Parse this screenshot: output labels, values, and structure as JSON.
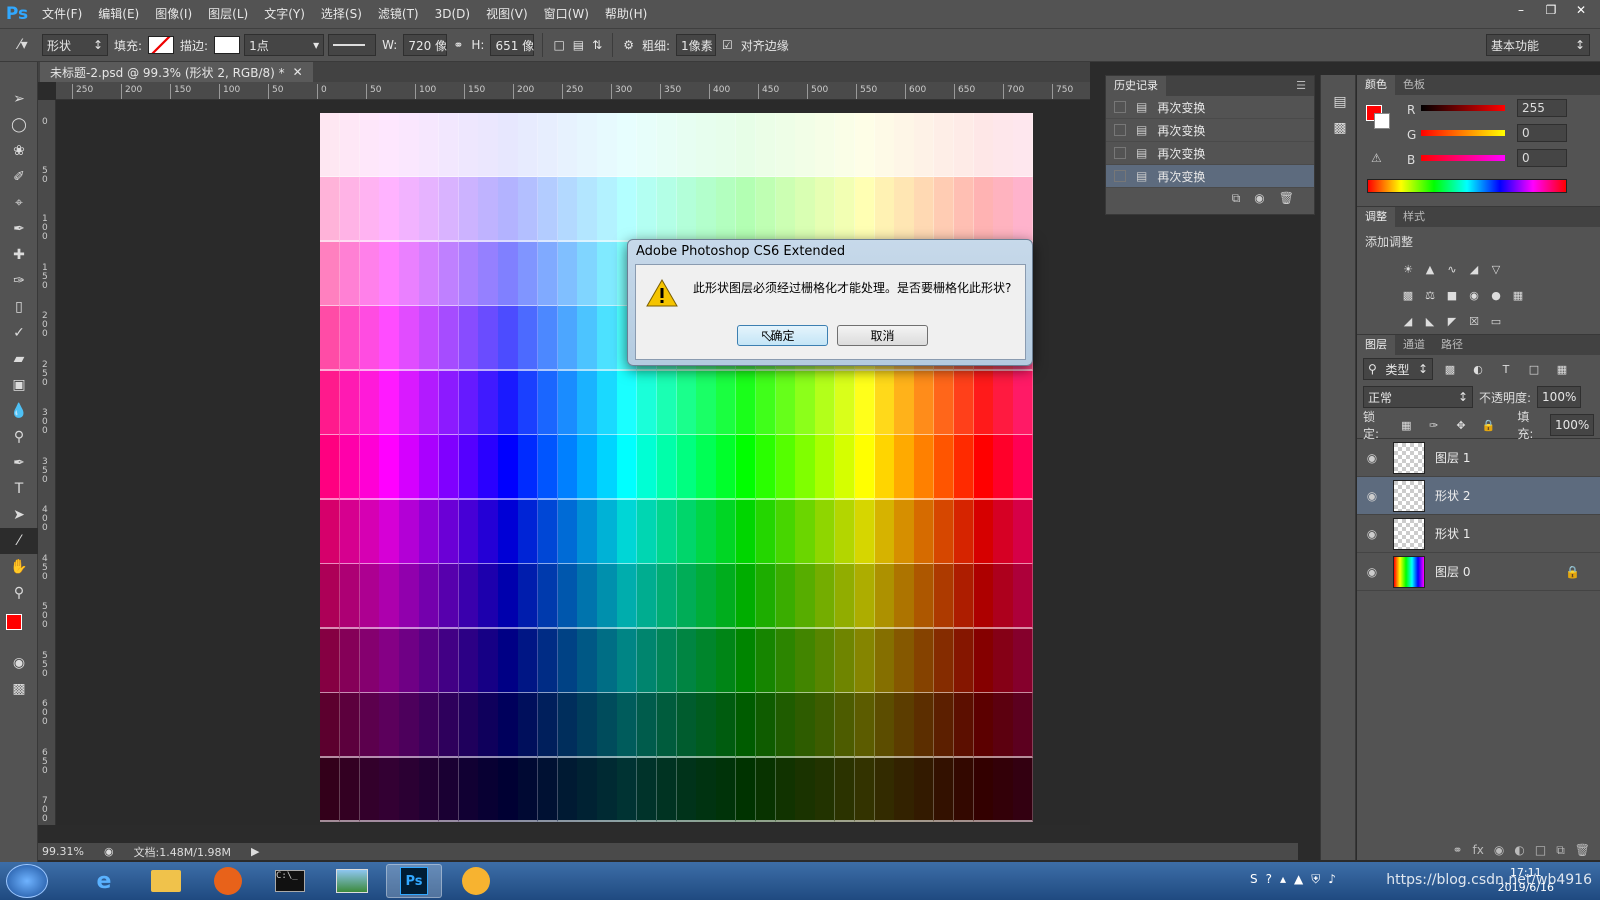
{
  "app": {
    "logo": "Ps"
  },
  "menu": [
    "文件(F)",
    "编辑(E)",
    "图像(I)",
    "图层(L)",
    "文字(Y)",
    "选择(S)",
    "滤镜(T)",
    "3D(D)",
    "视图(V)",
    "窗口(W)",
    "帮助(H)"
  ],
  "window_controls": [
    "minimize-icon",
    "restore-icon",
    "close-icon"
  ],
  "options": {
    "mode": "形状",
    "fill_label": "填充:",
    "stroke_label": "描边:",
    "stroke_width": "1点",
    "w_label": "W:",
    "w_value": "720 像",
    "h_label": "H:",
    "h_value": "651 像",
    "weight_label": "粗细:",
    "weight_value": "1像素",
    "align_edges_label": "对齐边缘",
    "align_edges_checked": true,
    "workspace": "基本功能"
  },
  "document": {
    "tab_title": "未标题-2.psd @ 99.3% (形状 2, RGB/8) *",
    "zoom": "99.31%",
    "doc_size": "文档:1.48M/1.98M",
    "ruler_top": [
      "250",
      "200",
      "150",
      "100",
      "50",
      "0",
      "50",
      "100",
      "150",
      "200",
      "250",
      "300",
      "350",
      "400",
      "450",
      "500",
      "550",
      "600",
      "650",
      "700",
      "750"
    ],
    "ruler_left": [
      "0",
      "5 0",
      "1 0 0",
      "1 5 0",
      "2 0 0",
      "2 5 0",
      "3 0 0",
      "3 5 0",
      "4 0 0",
      "4 5 0",
      "5 0 0",
      "5 5 0",
      "6 0 0",
      "6 5 0",
      "7 0 0"
    ]
  },
  "history": {
    "tab": "历史记录",
    "items": [
      "再次变换",
      "再次变换",
      "再次变换",
      "再次变换"
    ],
    "selected_index": 3
  },
  "color_panel": {
    "tabs": [
      "颜色",
      "色板"
    ],
    "r_label": "R",
    "g_label": "G",
    "b_label": "B",
    "r": "255",
    "g": "0",
    "b": "0",
    "foreground": "#ff0000"
  },
  "adjust_panel": {
    "tabs": [
      "调整",
      "样式"
    ],
    "title": "添加调整"
  },
  "layers_panel": {
    "tabs": [
      "图层",
      "通道",
      "路径"
    ],
    "filter": "类型",
    "blend_mode": "正常",
    "opacity_label": "不透明度:",
    "opacity": "100%",
    "lock_label": "锁定:",
    "fill_label": "填充:",
    "fill": "100%",
    "layers": [
      {
        "name": "图层 1",
        "selected": false
      },
      {
        "name": "形状 2",
        "selected": true
      },
      {
        "name": "形状 1",
        "selected": false
      },
      {
        "name": "图层 0",
        "selected": false
      }
    ]
  },
  "dialog": {
    "title": "Adobe Photoshop CS6 Extended",
    "message": "此形状图层必须经过栅格化才能处理。是否要栅格化此形状?",
    "ok": "确定",
    "cancel": "取消"
  },
  "taskbar": {
    "apps": [
      "ie-icon",
      "explorer-icon",
      "pdf-icon",
      "cmd-icon",
      "photo-viewer-icon",
      "photoshop-icon",
      "browser-icon"
    ],
    "active_app": "photoshop-icon",
    "time": "17:11",
    "date": "2019/6/16",
    "watermark": "https://blog.csdn.net/wb4916"
  }
}
